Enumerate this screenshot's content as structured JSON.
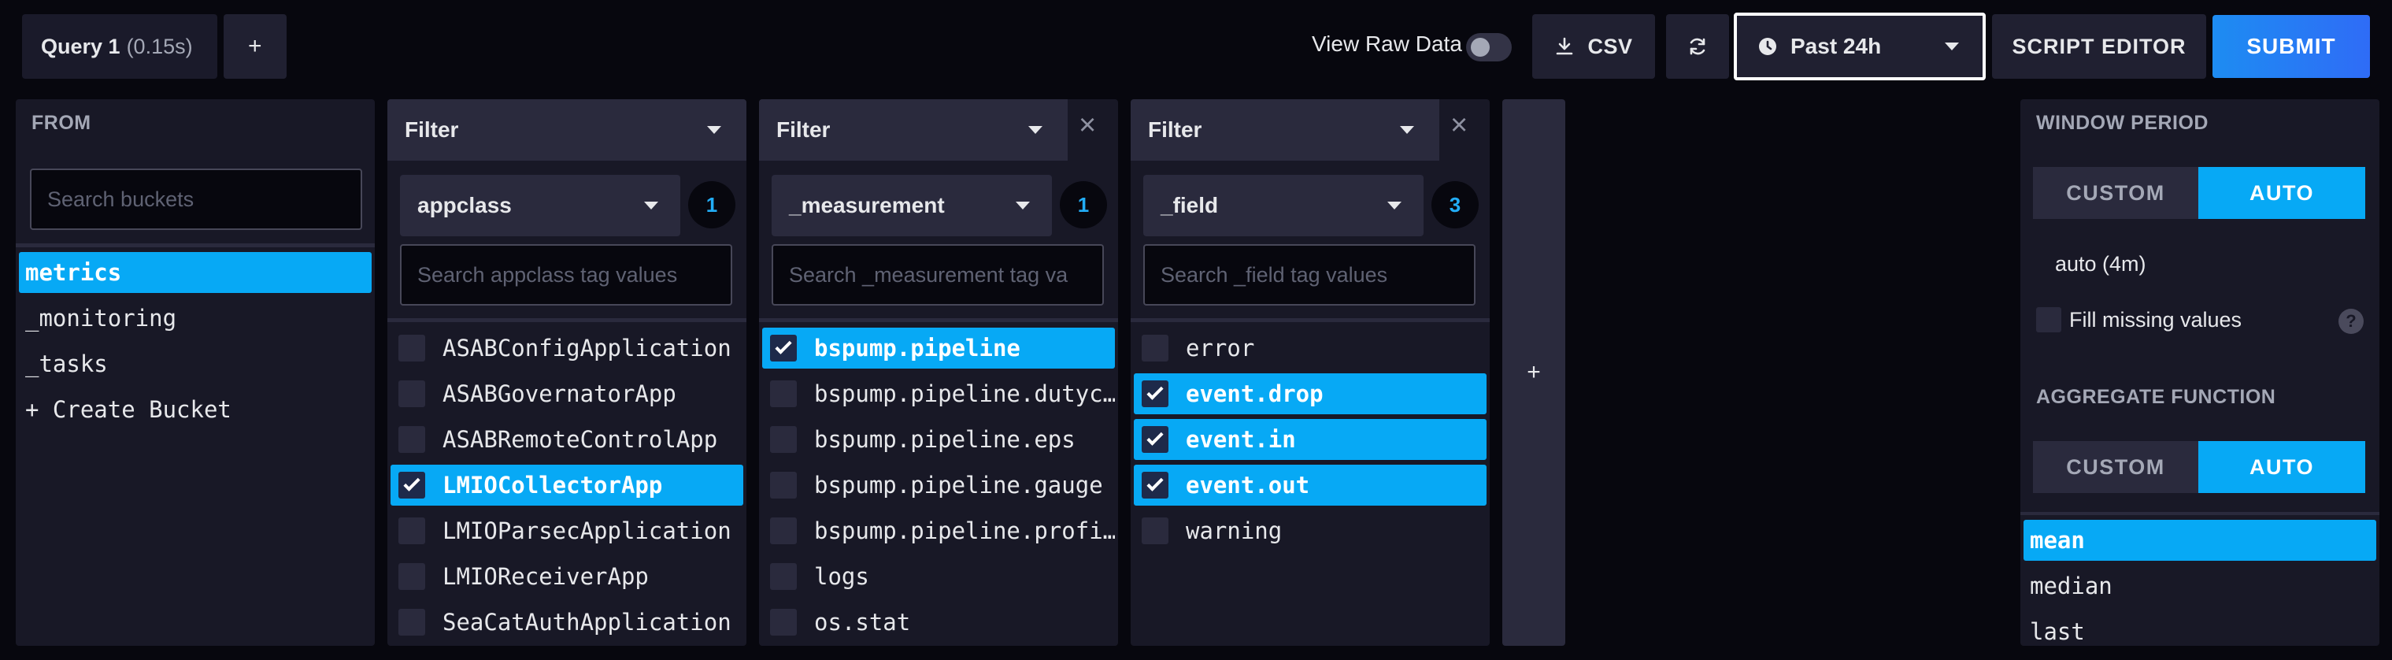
{
  "toolbar": {
    "query_tab": {
      "name": "Query 1",
      "time": "(0.15s)"
    },
    "add_tab": "+",
    "view_raw_label": "View Raw Data",
    "view_raw_on": false,
    "csv_label": "CSV",
    "time_range": "Past 24h",
    "script_editor_label": "SCRIPT EDITOR",
    "submit_label": "SUBMIT"
  },
  "from_panel": {
    "title": "FROM",
    "search_placeholder": "Search buckets",
    "buckets": [
      {
        "label": "metrics",
        "selected": true
      },
      {
        "label": "_monitoring",
        "selected": false
      },
      {
        "label": "_tasks",
        "selected": false
      },
      {
        "label": "+ Create Bucket",
        "selected": false
      }
    ]
  },
  "filters": [
    {
      "function": "Filter",
      "key": "appclass",
      "count": "1",
      "search_placeholder": "Search appclass tag values",
      "closable": false,
      "values": [
        {
          "label": "ASABConfigApplication",
          "checked": false
        },
        {
          "label": "ASABGovernatorApp",
          "checked": false
        },
        {
          "label": "ASABRemoteControlApp",
          "checked": false
        },
        {
          "label": "LMIOCollectorApp",
          "checked": true
        },
        {
          "label": "LMIOParsecApplication",
          "checked": false
        },
        {
          "label": "LMIOReceiverApp",
          "checked": false
        },
        {
          "label": "SeaCatAuthApplication",
          "checked": false
        }
      ]
    },
    {
      "function": "Filter",
      "key": "_measurement",
      "count": "1",
      "search_placeholder": "Search _measurement tag va",
      "closable": true,
      "values": [
        {
          "label": "bspump.pipeline",
          "checked": true
        },
        {
          "label": "bspump.pipeline.dutyc…",
          "checked": false
        },
        {
          "label": "bspump.pipeline.eps",
          "checked": false
        },
        {
          "label": "bspump.pipeline.gauge",
          "checked": false
        },
        {
          "label": "bspump.pipeline.profi…",
          "checked": false
        },
        {
          "label": "logs",
          "checked": false
        },
        {
          "label": "os.stat",
          "checked": false
        }
      ]
    },
    {
      "function": "Filter",
      "key": "_field",
      "count": "3",
      "search_placeholder": "Search _field tag values",
      "closable": true,
      "values": [
        {
          "label": "error",
          "checked": false
        },
        {
          "label": "event.drop",
          "checked": true
        },
        {
          "label": "event.in",
          "checked": true
        },
        {
          "label": "event.out",
          "checked": true
        },
        {
          "label": "warning",
          "checked": false
        }
      ]
    }
  ],
  "add_filter_label": "+",
  "right_panel": {
    "window_period_title": "WINDOW PERIOD",
    "window_custom": "CUSTOM",
    "window_auto": "AUTO",
    "window_value": "auto (4m)",
    "fill_missing_label": "Fill missing values",
    "help_glyph": "?",
    "aggregate_title": "AGGREGATE FUNCTION",
    "agg_custom": "CUSTOM",
    "agg_auto": "AUTO",
    "functions": [
      {
        "label": "mean",
        "selected": true
      },
      {
        "label": "median",
        "selected": false
      },
      {
        "label": "last",
        "selected": false
      }
    ]
  },
  "colors": {
    "background": "#07070e",
    "panel": "#181826",
    "selected": "#07a9f5",
    "accent_badge": "#22adf6"
  },
  "icons": {
    "csv": "download-icon",
    "refresh": "refresh-icon",
    "time": "clock-icon"
  }
}
